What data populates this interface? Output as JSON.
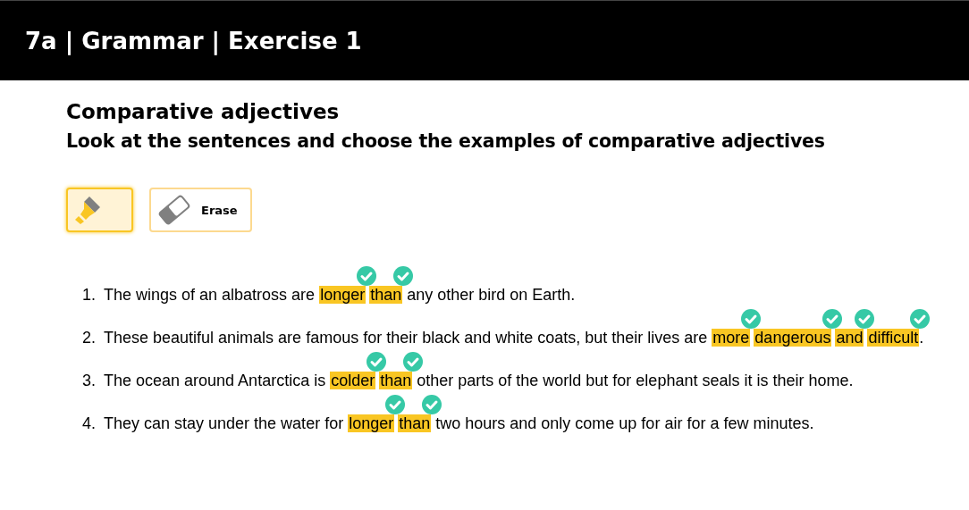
{
  "header": {
    "title": "7a | Grammar | Exercise 1"
  },
  "heading": "Comparative adjectives",
  "instruction": "Look at the sentences and choose the examples of comparative adjectives",
  "tools": [
    {
      "kind": "highlighter",
      "selected": true
    },
    {
      "kind": "eraser",
      "label": "Erase",
      "selected": false
    }
  ],
  "sentences": [
    {
      "number": "1.",
      "parts": [
        {
          "text": "The wings of an albatross are ",
          "highlighted": false,
          "correct": false
        },
        {
          "text": "longer",
          "highlighted": true,
          "correct": true
        },
        {
          "text": "than",
          "highlighted": true,
          "correct": true
        },
        {
          "text": " any other bird on Earth.",
          "highlighted": false,
          "correct": false
        }
      ]
    },
    {
      "number": "2.",
      "parts": [
        {
          "text": "These beautiful animals are famous for their black and white coats, but their lives are ",
          "highlighted": false,
          "correct": false
        },
        {
          "text": "more",
          "highlighted": true,
          "correct": true
        },
        {
          "text": "dangerous",
          "highlighted": true,
          "correct": true
        },
        {
          "text": "and",
          "highlighted": true,
          "correct": true
        },
        {
          "text": "difficult",
          "highlighted": true,
          "correct": true
        },
        {
          "text": ".",
          "highlighted": false,
          "correct": false
        }
      ]
    },
    {
      "number": "3.",
      "parts": [
        {
          "text": "The ocean around Antarctica is ",
          "highlighted": false,
          "correct": false
        },
        {
          "text": "colder",
          "highlighted": true,
          "correct": true
        },
        {
          "text": "than",
          "highlighted": true,
          "correct": true
        },
        {
          "text": " other parts of the world but for elephant seals it is their home.",
          "highlighted": false,
          "correct": false
        }
      ]
    },
    {
      "number": "4.",
      "parts": [
        {
          "text": "They can stay under the water for ",
          "highlighted": false,
          "correct": false
        },
        {
          "text": "longer",
          "highlighted": true,
          "correct": true
        },
        {
          "text": "than",
          "highlighted": true,
          "correct": true
        },
        {
          "text": " two hours and only come up for air for a few minutes.",
          "highlighted": false,
          "correct": false
        }
      ]
    }
  ]
}
